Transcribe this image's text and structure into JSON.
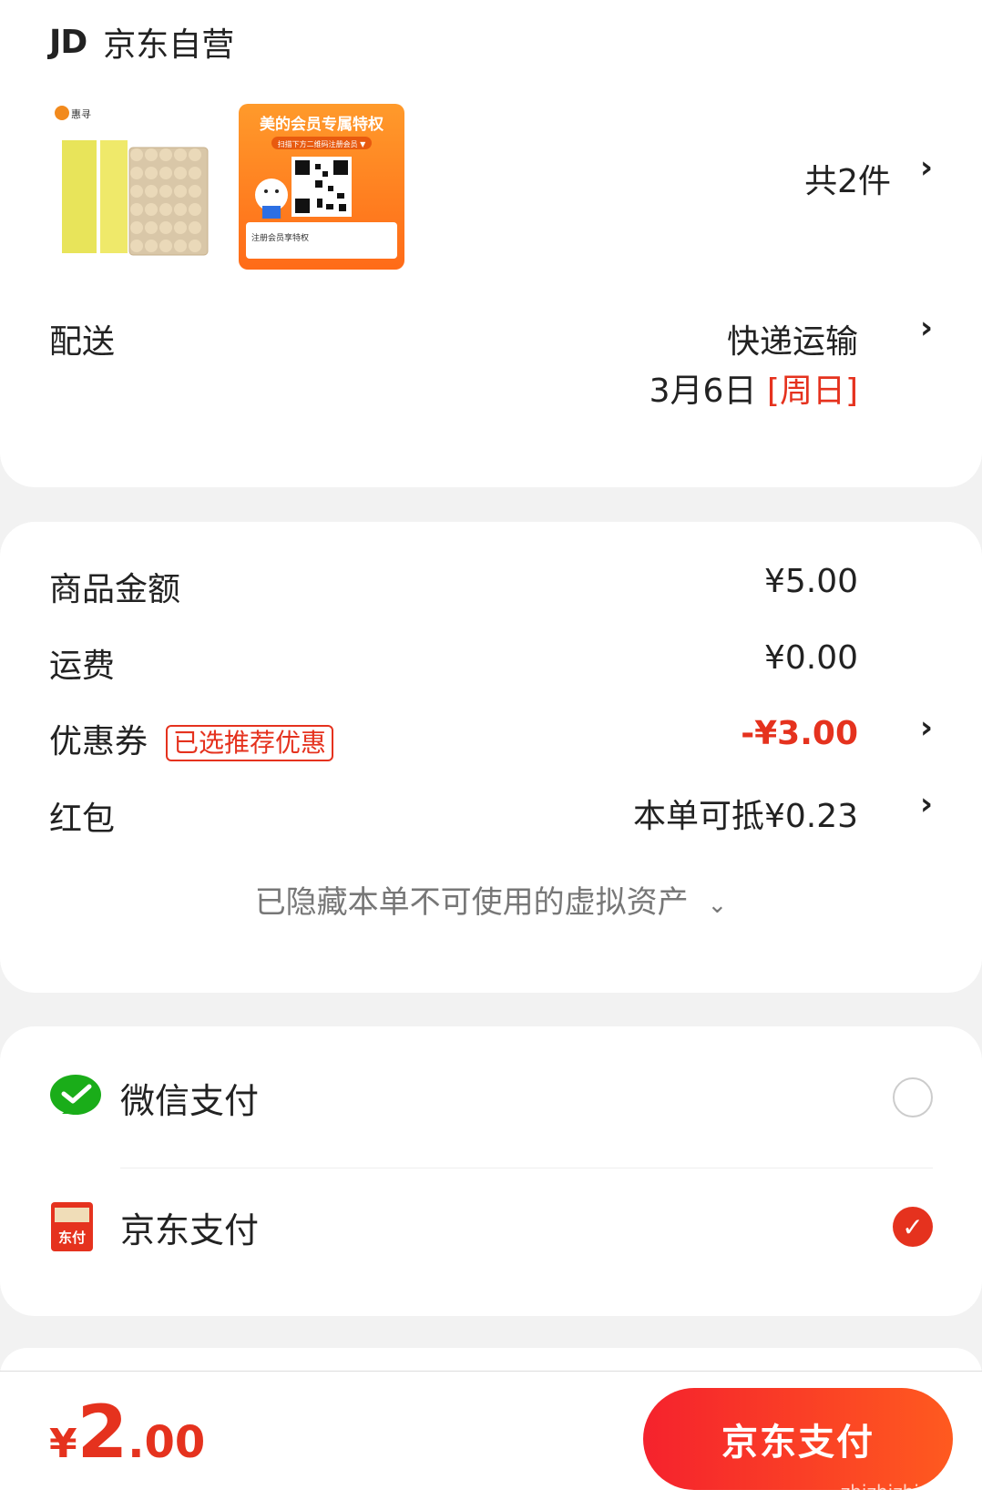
{
  "store": {
    "logo": "JD",
    "name": "京东自营",
    "count_label": "共2件"
  },
  "products": [
    {
      "name": "huixun-tissue-product",
      "brand_text": "惠寻"
    },
    {
      "name": "midea-member-card",
      "promo_title": "美的会员专属特权",
      "promo_sub": "扫描下方二维码注册会员 ▼",
      "promo_bottom": "注册会员享特权"
    }
  ],
  "delivery": {
    "label": "配送",
    "method": "快递运输",
    "date": "3月6日",
    "weekday": "[周日]"
  },
  "pricing": {
    "goods_label": "商品金额",
    "goods_value": "¥5.00",
    "shipping_label": "运费",
    "shipping_value": "¥0.00",
    "coupon_label": "优惠券",
    "coupon_tag": "已选推荐优惠",
    "coupon_value": "-¥3.00",
    "redpacket_label": "红包",
    "redpacket_value": "本单可抵¥0.23",
    "hidden_assets": "已隐藏本单不可使用的虚拟资产"
  },
  "payment": {
    "options": [
      {
        "label": "微信支付",
        "selected": false,
        "icon": "wechat-pay-icon"
      },
      {
        "label": "京东支付",
        "selected": true,
        "icon": "jd-pay-icon"
      }
    ]
  },
  "footer": {
    "currency": "¥",
    "total_int": "2",
    "total_dec": ".00",
    "pay_button": "京东支付",
    "watermark": "zhizhizhi.com"
  },
  "colors": {
    "accent": "#e5321e",
    "wechat": "#1aad19"
  }
}
